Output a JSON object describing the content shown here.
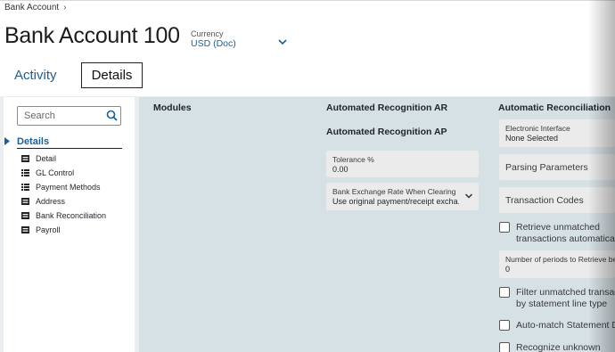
{
  "breadcrumb": {
    "items": [
      "Bank Account"
    ],
    "separator": "›"
  },
  "page": {
    "title": "Bank Account 100"
  },
  "currency": {
    "label": "Currency",
    "value": "USD (Doc)"
  },
  "tabs": [
    {
      "label": "Activity",
      "active": false
    },
    {
      "label": "Details",
      "active": true
    }
  ],
  "sidebar": {
    "search_placeholder": "Search",
    "section_label": "Details",
    "items": [
      {
        "label": "Detail",
        "icon": "form-icon"
      },
      {
        "label": "GL Control",
        "icon": "list-icon"
      },
      {
        "label": "Payment Methods",
        "icon": "list-icon"
      },
      {
        "label": "Address",
        "icon": "form-icon"
      },
      {
        "label": "Bank Reconciliation",
        "icon": "form-icon"
      },
      {
        "label": "Payroll",
        "icon": "form-icon"
      }
    ]
  },
  "columns": {
    "modules": {
      "heading": "Modules"
    },
    "auto_recognition": {
      "heading_ar": "Automated Recognition AR",
      "heading_ap": "Automated Recognition AP",
      "tolerance": {
        "label": "Tolerance %",
        "value": "0.00"
      },
      "exchange_rate": {
        "label": "Bank Exchange Rate When Clearing",
        "value": "Use original payment/receipt excha..."
      }
    },
    "auto_reconciliation": {
      "heading": "Automatic Reconciliation",
      "electronic_interface": {
        "label": "Electronic Interface",
        "value": "None Selected"
      },
      "parsing_parameters": "Parsing Parameters",
      "transaction_codes": "Transaction Codes",
      "retrieve_unmatched": {
        "line1": "Retrieve unmatched",
        "line2": "transactions automaticall",
        "checked": false
      },
      "periods_to_retrieve": {
        "label": "Number of periods to Retrieve be",
        "value": "0"
      },
      "filter_unmatched": {
        "line1": "Filter unmatched transact",
        "line2": "by statement line type",
        "checked": false
      },
      "auto_match": {
        "label": "Auto-match Statement De",
        "checked": false
      },
      "recognize_unknown": {
        "label": "Recognize unknown",
        "checked": false
      }
    }
  },
  "colors": {
    "accent": "#1a5f99",
    "content_bg": "#d6e1e6",
    "field_bg": "#ebebeb",
    "page_bg": "#ebeef0"
  }
}
